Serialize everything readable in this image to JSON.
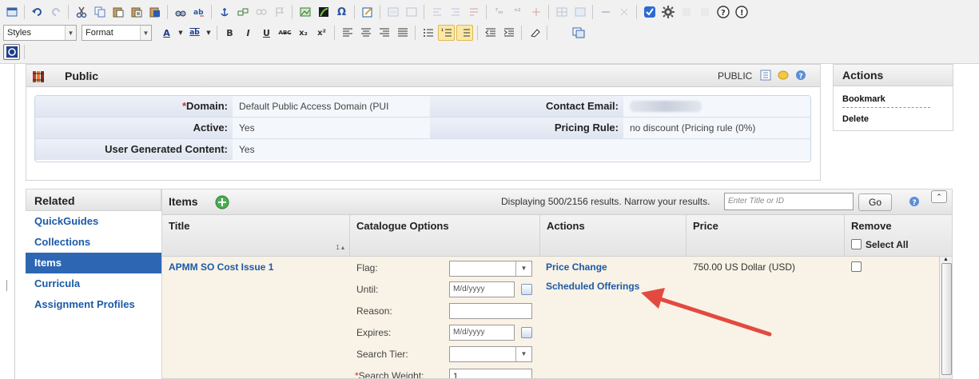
{
  "toolbar": {
    "row1_icons": [
      "source-icon",
      "undo-icon",
      "redo-icon",
      "cut-icon",
      "copy-icon",
      "paste-icon",
      "paste-text-icon",
      "paste-word-icon",
      "find-icon",
      "replace-icon",
      "anchor-icon",
      "link-icon",
      "unlink-icon",
      "image-icon",
      "flash-icon",
      "special-char-icon",
      "table-icon",
      "edit-icon",
      "box-icon",
      "box2-icon",
      "list-icon",
      "list2-icon",
      "list3-icon",
      "sub-icon",
      "sup-icon",
      "grid-icon",
      "grid2-icon",
      "line-icon",
      "check-icon",
      "gear-icon",
      "help-icon",
      "info-icon"
    ],
    "styles_select": "Styles",
    "format_select": "Format",
    "bold": "B",
    "italic": "I",
    "underline": "U",
    "strike": "ABC",
    "subscript": "x₂",
    "superscript": "x²"
  },
  "public_panel": {
    "title": "Public",
    "status": "PUBLIC",
    "fields": {
      "domain_label": "Domain:",
      "domain_required": "*",
      "domain_value": "Default Public Access Domain (PUI",
      "active_label": "Active:",
      "active_value": "Yes",
      "ugc_label": "User Generated Content:",
      "ugc_value": "Yes",
      "email_label": "Contact Email:",
      "email_value": "",
      "pricing_label": "Pricing Rule:",
      "pricing_value": "no discount (Pricing rule (0%)"
    }
  },
  "actions_panel": {
    "title": "Actions",
    "bookmark": "Bookmark",
    "delete": "Delete"
  },
  "related": {
    "title": "Related",
    "items": [
      {
        "label": "QuickGuides",
        "selected": false
      },
      {
        "label": "Collections",
        "selected": false
      },
      {
        "label": "Items",
        "selected": true
      },
      {
        "label": "Curricula",
        "selected": false
      },
      {
        "label": "Assignment Profiles",
        "selected": false
      }
    ]
  },
  "items": {
    "title": "Items",
    "displaying": "Displaying 500/2156 results. Narrow your results.",
    "search_placeholder": "Enter Title or ID",
    "go_button": "Go",
    "columns": {
      "title": "Title",
      "sort_indicator": "1 ▴",
      "catalogue": "Catalogue Options",
      "actions": "Actions",
      "price": "Price",
      "remove": "Remove",
      "select_all": "Select All"
    },
    "row": {
      "title": "APMM SO Cost Issue 1",
      "flag_label": "Flag:",
      "until_label": "Until:",
      "until_placeholder": "M/d/yyyy",
      "reason_label": "Reason:",
      "expires_label": "Expires:",
      "expires_placeholder": "M/d/yyyy",
      "tier_label": "Search Tier:",
      "weight_required": "*",
      "weight_label": "Search Weight:",
      "weight_value": "1",
      "price_change": "Price Change",
      "scheduled_offerings": "Scheduled Offerings",
      "price": "750.00 US Dollar (USD)"
    }
  },
  "colors": {
    "link": "#1a5aa8",
    "selected_nav": "#2d67b4",
    "annotation_arrow": "#e34a3f",
    "row_background": "#f9f2e6"
  }
}
